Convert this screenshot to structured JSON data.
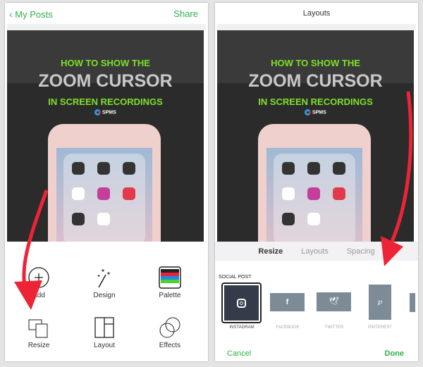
{
  "left": {
    "back_label": "My Posts",
    "share_label": "Share",
    "post": {
      "line1": "HOW TO SHOW THE",
      "line2": "ZOOM CURSOR",
      "line3": "IN SCREEN RECORDINGS",
      "logo": "SPMS"
    },
    "tools": [
      {
        "label": "Add",
        "icon": "plus-circle-icon"
      },
      {
        "label": "Design",
        "icon": "magic-wand-icon"
      },
      {
        "label": "Palette",
        "icon": "palette-icon"
      },
      {
        "label": "Resize",
        "icon": "resize-icon"
      },
      {
        "label": "Layout",
        "icon": "layout-icon"
      },
      {
        "label": "Effects",
        "icon": "effects-icon"
      }
    ],
    "palette_colors": [
      "#222222",
      "#e8213f",
      "#1a8fe0",
      "#4ed12a"
    ]
  },
  "right": {
    "title": "Layouts",
    "tabs": [
      {
        "label": "Resize",
        "active": true
      },
      {
        "label": "Layouts"
      },
      {
        "label": "Spacing"
      }
    ],
    "section_label": "SOCIAL POST",
    "formats": [
      {
        "label": "INSTAGRAM",
        "selected": true
      },
      {
        "label": "FACEBOOK"
      },
      {
        "label": "TWITTER"
      },
      {
        "label": "PINTEREST"
      }
    ],
    "cancel_label": "Cancel",
    "done_label": "Done"
  },
  "colors": {
    "accent": "#2db14b",
    "arrow": "#ee2436"
  }
}
